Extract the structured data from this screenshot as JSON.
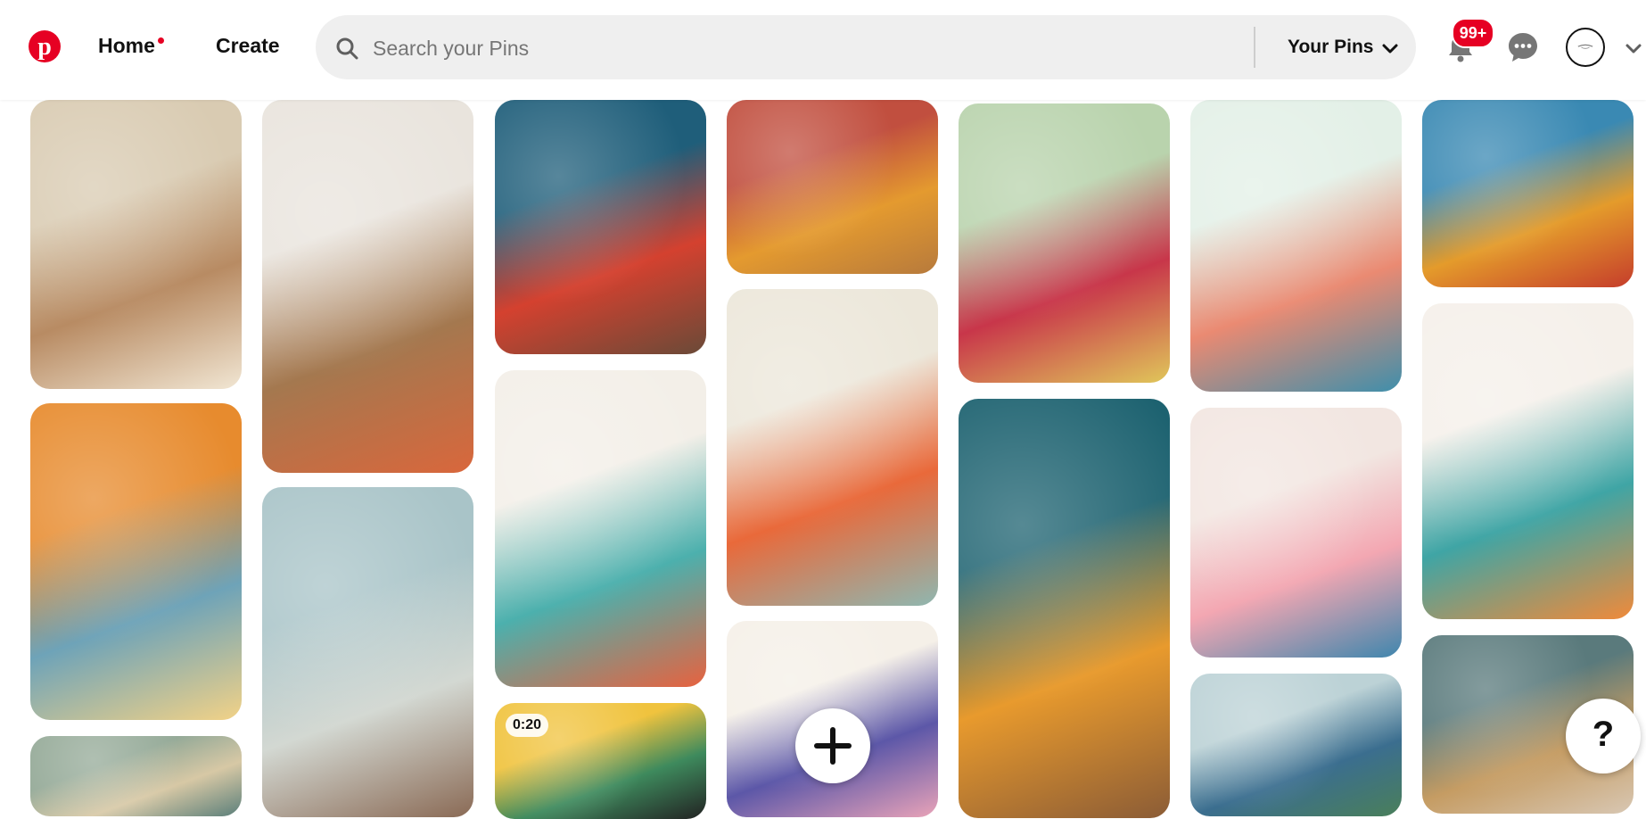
{
  "header": {
    "home_label": "Home",
    "create_label": "Create",
    "search_placeholder": "Search your Pins",
    "search_scope": "Your Pins",
    "notifications_badge": "99+",
    "brand_color": "#e60023"
  },
  "pins": [
    {
      "colors": [
        "#d9cbb2",
        "#b88b63",
        "#f1e6d3"
      ],
      "icon": "kitchen-image"
    },
    {
      "colors": [
        "#e78b2e",
        "#6ea3b8",
        "#f2d287"
      ],
      "icon": "bedroom-image"
    },
    {
      "colors": [
        "#95aa98",
        "#d7c8a5",
        "#5b7f7a"
      ],
      "icon": "floral-room-image"
    },
    {
      "colors": [
        "#e9e4dd",
        "#a4784f",
        "#d9673c"
      ],
      "icon": "bedroom-image"
    },
    {
      "colors": [
        "#a9c4c8",
        "#d3d8d2",
        "#8a6a55"
      ],
      "icon": "staircase-image"
    },
    {
      "colors": [
        "#1f5e7a",
        "#d4412f",
        "#6a4a38"
      ],
      "icon": "bedroom-image"
    },
    {
      "colors": [
        "#f3efe8",
        "#4cb0ad",
        "#e7623f"
      ],
      "icon": "bedroom-image"
    },
    {
      "colors": [
        "#f0c33e",
        "#3e8a5d",
        "#222"
      ],
      "icon": "video-image",
      "duration": "0:20"
    },
    {
      "colors": [
        "#c14f3f",
        "#e49a2f",
        "#b77a3c"
      ],
      "icon": "bedroom-image"
    },
    {
      "colors": [
        "#ece7da",
        "#e9693a",
        "#8fb7b0"
      ],
      "icon": "bedroom-image"
    },
    {
      "colors": [
        "#f5f0e8",
        "#5c57a8",
        "#e9a3b8"
      ],
      "icon": "wildflower-image"
    },
    {
      "colors": [
        "#b9d3ad",
        "#c8364a",
        "#e0c65a"
      ],
      "icon": "bedroom-image"
    },
    {
      "colors": [
        "#1d6270",
        "#e89a2d",
        "#8b5c36"
      ],
      "icon": "bedroom-image"
    },
    {
      "colors": [
        "#e3f0e7",
        "#ea8a72",
        "#3f8fab"
      ],
      "icon": "bedroom-image"
    },
    {
      "colors": [
        "#f2e6e1",
        "#f3a7b2",
        "#3f86ad"
      ],
      "icon": "kitchen-image"
    },
    {
      "colors": [
        "#bcd2d6",
        "#3b6e8f",
        "#4a7f5a"
      ],
      "icon": "mural-image"
    },
    {
      "colors": [
        "#3a89b3",
        "#e49b2b",
        "#c53d2b"
      ],
      "icon": "bedroom-image"
    },
    {
      "colors": [
        "#f5f0ea",
        "#3fa5a5",
        "#f08a3a"
      ],
      "icon": "bedroom-image"
    },
    {
      "colors": [
        "#5a7a7c",
        "#c59c63",
        "#d8c7b3"
      ],
      "icon": "doorway-image"
    }
  ]
}
